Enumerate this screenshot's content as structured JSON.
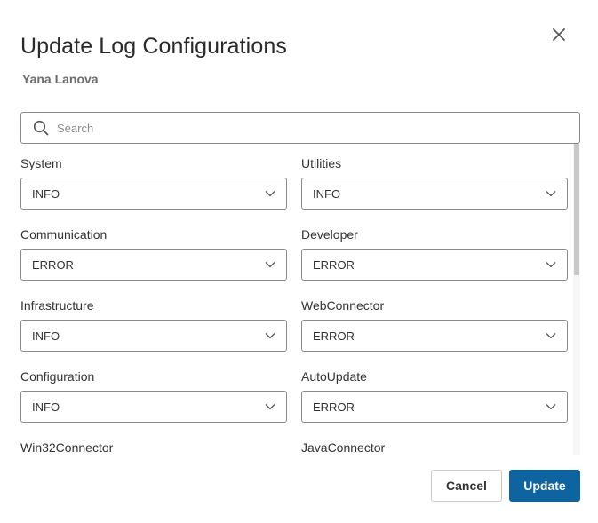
{
  "dialog": {
    "title": "Update Log Configurations",
    "subtitle": "Yana Lanova",
    "close_icon": "close-icon"
  },
  "search": {
    "placeholder": "Search",
    "value": "",
    "icon": "search-icon"
  },
  "fields": [
    {
      "label": "System",
      "value": "INFO"
    },
    {
      "label": "Utilities",
      "value": "INFO"
    },
    {
      "label": "Communication",
      "value": "ERROR"
    },
    {
      "label": "Developer",
      "value": "ERROR"
    },
    {
      "label": "Infrastructure",
      "value": "INFO"
    },
    {
      "label": "WebConnector",
      "value": "ERROR"
    },
    {
      "label": "Configuration",
      "value": "INFO"
    },
    {
      "label": "AutoUpdate",
      "value": "ERROR"
    },
    {
      "label": "Win32Connector",
      "value": ""
    },
    {
      "label": "JavaConnector",
      "value": ""
    }
  ],
  "footer": {
    "cancel_label": "Cancel",
    "update_label": "Update"
  },
  "colors": {
    "primary": "#0e63a1",
    "border": "#8a8a8a",
    "scroll_thumb": "#c9c9c9"
  }
}
